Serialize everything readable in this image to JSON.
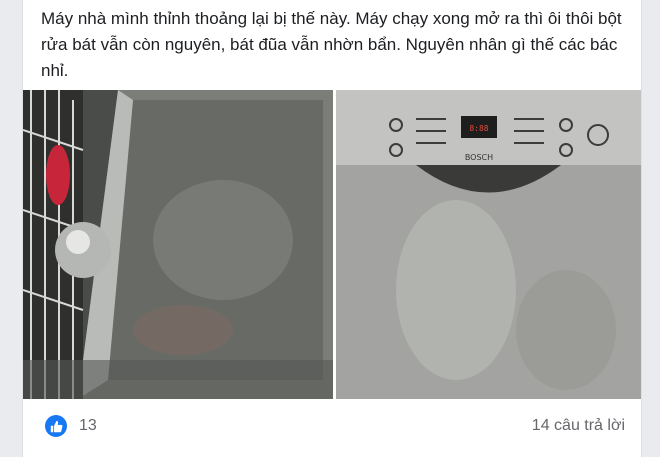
{
  "post": {
    "text": "Máy nhà mình thỉnh thoảng lại bị thế này. Máy chạy xong mở ra thì ôi thôi bột rửa bát vẫn còn nguyên, bát đũa vẫn nhờn bẩn. Nguyên nhân gì thế các bác nhỉ."
  },
  "photos": {
    "right": {
      "brand_text": "BOSCH"
    }
  },
  "footer": {
    "like_icon": "thumbs-up-icon",
    "like_count": "13",
    "reply_count": "14 câu trả lời",
    "like_color": "#1877f2"
  }
}
